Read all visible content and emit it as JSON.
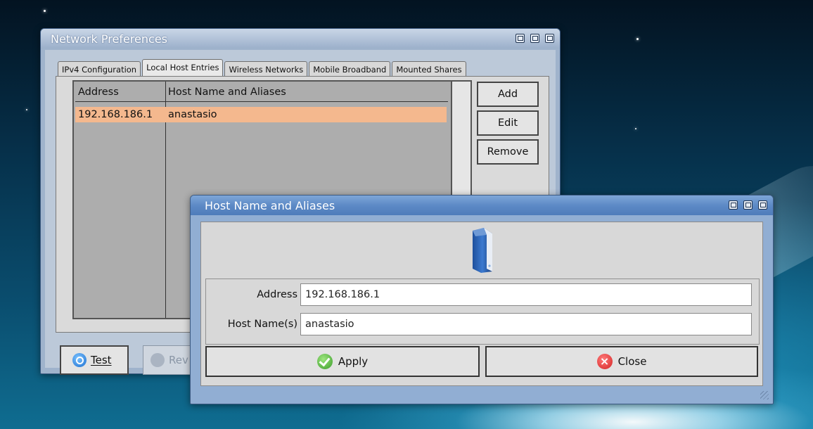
{
  "network_window": {
    "title": "Network Preferences",
    "tabs": [
      {
        "label": "IPv4 Configuration",
        "active": false
      },
      {
        "label": "Local Host Entries",
        "active": true
      },
      {
        "label": "Wireless Networks",
        "active": false
      },
      {
        "label": "Mobile Broadband",
        "active": false
      },
      {
        "label": "Mounted Shares",
        "active": false
      }
    ],
    "table": {
      "headers": [
        "Address",
        "Host Name and Aliases"
      ],
      "rows": [
        {
          "address": "192.168.186.1",
          "host": "anastasio",
          "selected": true
        }
      ]
    },
    "side_buttons": {
      "add": "Add",
      "edit": "Edit",
      "remove": "Remove"
    },
    "bottom_buttons": {
      "test": "Test",
      "revert_partial": "Rev"
    }
  },
  "host_dialog": {
    "title": "Host Name and Aliases",
    "icon": "server-icon",
    "address_label": "Address",
    "address_value": "192.168.186.1",
    "hostname_label": "Host Name(s)",
    "hostname_value": "anastasio",
    "apply_label": "Apply",
    "close_label": "Close"
  },
  "colors": {
    "selection": "#f4b88e",
    "dialog_titlebar": "#5d8ac6",
    "window_titlebar": "#aebfd6"
  }
}
